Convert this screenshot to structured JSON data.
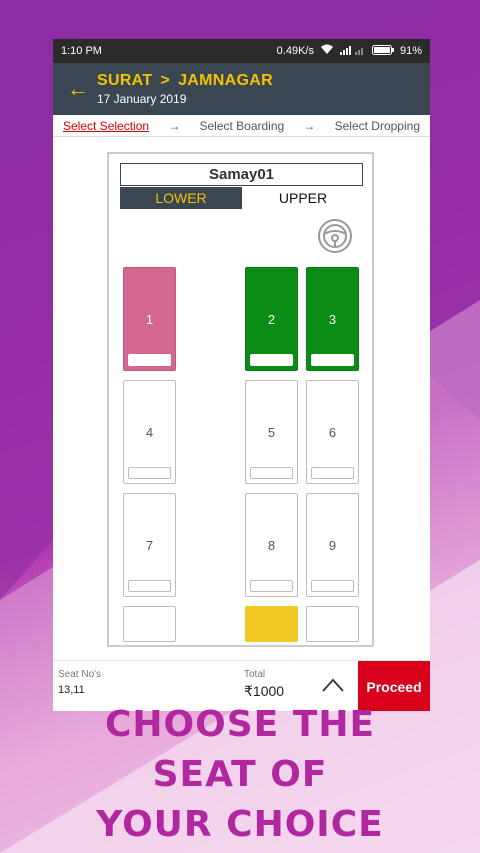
{
  "status_bar": {
    "time": "1:10 PM",
    "net_speed": "0.49K/s",
    "battery": "91%"
  },
  "header": {
    "from": "SURAT",
    "separator": ">",
    "to": "JAMNAGAR",
    "date": "17 January 2019",
    "back_icon": "arrow-left-icon"
  },
  "steps": {
    "items": [
      "Select Selection",
      "Select Boarding",
      "Select Dropping"
    ],
    "arrow": "→"
  },
  "bus": {
    "name": "Samay01",
    "decks": [
      "LOWER",
      "UPPER"
    ],
    "active_deck": "LOWER"
  },
  "seats": [
    {
      "label": "1",
      "state": "booked"
    },
    {
      "label": "2",
      "state": "selected"
    },
    {
      "label": "3",
      "state": "selected"
    },
    {
      "label": "4",
      "state": "available"
    },
    {
      "label": "5",
      "state": "available"
    },
    {
      "label": "6",
      "state": "available"
    },
    {
      "label": "7",
      "state": "available"
    },
    {
      "label": "8",
      "state": "available"
    },
    {
      "label": "9",
      "state": "available"
    }
  ],
  "colors": {
    "booked": "#d4678f",
    "selected": "#0b8c14",
    "accent": "#f2c200",
    "proceed": "#d9001b"
  },
  "footer": {
    "seat_label": "Seat No's",
    "seat_value": "13,11",
    "total_label": "Total",
    "total_value": "₹1000",
    "proceed_label": "Proceed"
  },
  "promo": {
    "line1": "Choose The",
    "line2": "Seat Of",
    "line3": "Your Choice"
  }
}
